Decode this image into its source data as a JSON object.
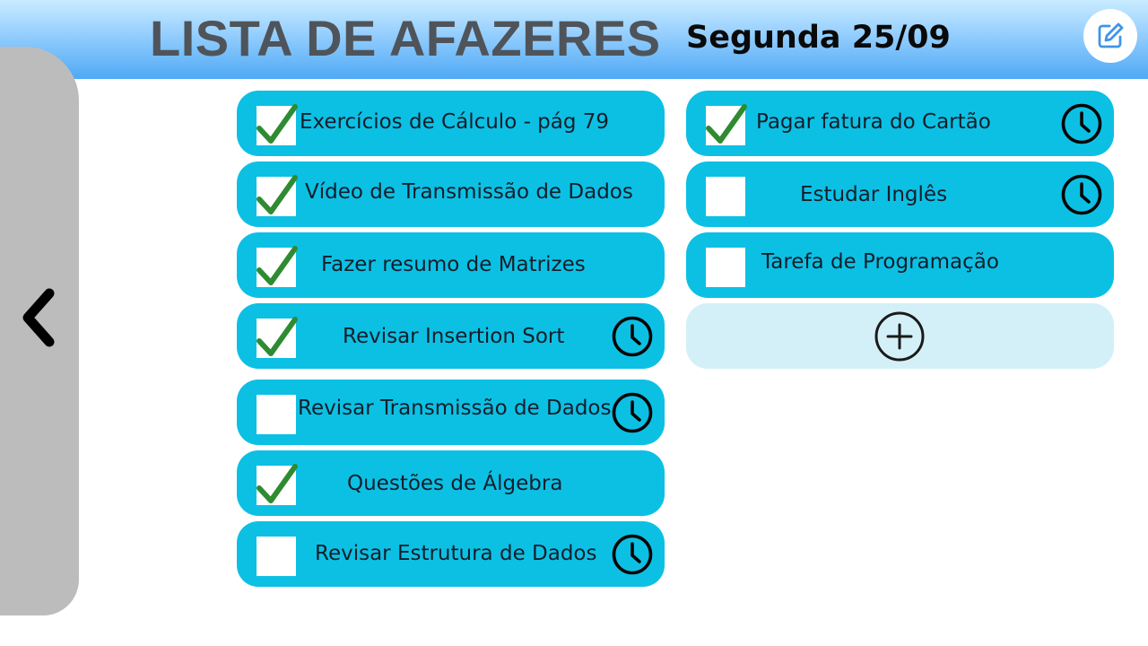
{
  "header": {
    "title": "LISTA DE AFAZERES",
    "date": "Segunda 25/09",
    "edit_icon": "edit-icon"
  },
  "side_panel": {
    "back_icon": "chevron-left-icon"
  },
  "tasks_left": [
    {
      "label": "Exercícios de Cálculo - pág 79",
      "checked": true,
      "reminder": false
    },
    {
      "label": "Vídeo de Transmissão de Dados",
      "checked": true,
      "reminder": false
    },
    {
      "label": "Fazer resumo de Matrizes",
      "checked": true,
      "reminder": false
    },
    {
      "label": "Revisar Insertion Sort",
      "checked": true,
      "reminder": true
    },
    {
      "label": "Revisar Transmissão de Dados",
      "checked": false,
      "reminder": true
    },
    {
      "label": "Questões de Álgebra",
      "checked": true,
      "reminder": false
    },
    {
      "label": "Revisar Estrutura de Dados",
      "checked": false,
      "reminder": true
    }
  ],
  "tasks_right": [
    {
      "label": "Pagar fatura do Cartão",
      "checked": true,
      "reminder": true
    },
    {
      "label": "Estudar Inglês",
      "checked": false,
      "reminder": true
    },
    {
      "label": "Tarefa de Programação",
      "checked": false,
      "reminder": false
    }
  ],
  "add_task": {
    "icon": "plus-circle-icon"
  },
  "colors": {
    "task_bg": "#0cc0e4",
    "add_bg": "#d3f0f8",
    "check": "#2e8b32",
    "title": "#4f545a"
  }
}
